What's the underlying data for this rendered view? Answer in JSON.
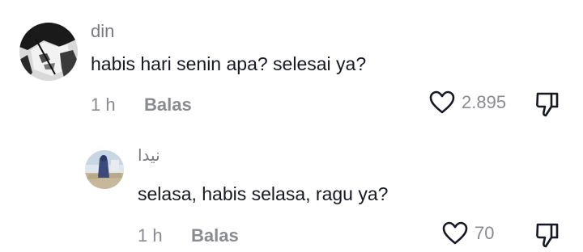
{
  "comments": [
    {
      "username": "din",
      "text": "habis hari senin apa? selesai ya?",
      "time": "1 h",
      "reply_label": "Balas",
      "likes": "2.895",
      "avatar": "grayscale-anime-avatar"
    },
    {
      "username": "نيدا",
      "text": "selasa, habis selasa, ragu ya?",
      "time": "1 h",
      "reply_label": "Balas",
      "likes": "70",
      "avatar": "outdoor-figure-avatar"
    }
  ],
  "icons": {
    "like": "heart-outline-icon",
    "dislike": "thumbs-down-icon"
  },
  "colors": {
    "primary_text": "#161823",
    "secondary_text": "#8a8b91"
  }
}
